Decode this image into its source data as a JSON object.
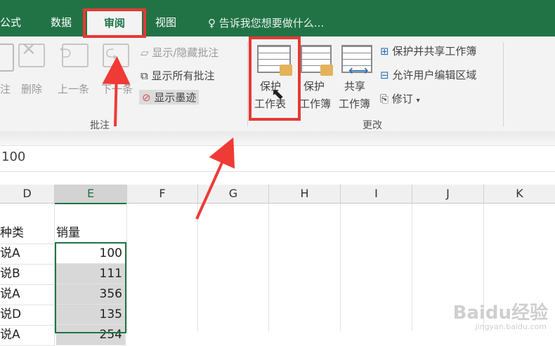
{
  "tabs": {
    "formula": "公式",
    "data": "数据",
    "review": "审阅",
    "view": "视图"
  },
  "tell_me": "告诉我您想要做什么...",
  "comments": {
    "new": "注",
    "delete": "删除",
    "prev": "上一条",
    "next": "下一条",
    "show_hide": "显示/隐藏批注",
    "show_all": "显示所有批注",
    "show_ink": "显示墨迹",
    "group": "批注"
  },
  "changes": {
    "protect_sheet": "保护\n工作表",
    "protect_sheet_l1": "保护",
    "protect_sheet_l2": "工作表",
    "protect_wb_l1": "保护",
    "protect_wb_l2": "工作簿",
    "share_l1": "共享",
    "share_l2": "工作簿",
    "protect_share": "保护并共享工作簿",
    "allow_edit": "允许用户编辑区域",
    "track": "修订",
    "group": "更改"
  },
  "formula_value": "100",
  "columns": [
    "D",
    "E",
    "F",
    "G",
    "H",
    "I",
    "J",
    "K"
  ],
  "rows": [
    {
      "d": "种类",
      "e": "销量"
    },
    {
      "d": "说A",
      "e": "100"
    },
    {
      "d": "说B",
      "e": "111"
    },
    {
      "d": "说A",
      "e": "356"
    },
    {
      "d": "说D",
      "e": "135"
    },
    {
      "d": "说A",
      "e": "254"
    }
  ],
  "watermark": {
    "logo": "Baidu经验",
    "url": "jingyan.baidu.com"
  }
}
